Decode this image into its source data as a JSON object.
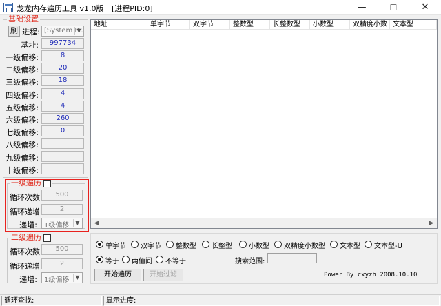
{
  "window": {
    "title": "龙龙内存遍历工具 v1.0版",
    "pid_label": "[进程PID:0]",
    "minimize": "—",
    "maximize": "☐",
    "close": "✕"
  },
  "basic": {
    "title": "基础设置",
    "refresh_label": "刷",
    "process_label": "进程:",
    "process_value": "[System Pr...",
    "base_label": "基址:",
    "base_value": "997734",
    "offsets": [
      {
        "label": "一级偏移:",
        "value": "8"
      },
      {
        "label": "二级偏移:",
        "value": "20"
      },
      {
        "label": "三级偏移:",
        "value": "18"
      },
      {
        "label": "四级偏移:",
        "value": "4"
      },
      {
        "label": "五级偏移:",
        "value": "4"
      },
      {
        "label": "六级偏移:",
        "value": "260"
      },
      {
        "label": "七级偏移:",
        "value": "0"
      },
      {
        "label": "八级偏移:",
        "value": ""
      },
      {
        "label": "九级偏移:",
        "value": ""
      },
      {
        "label": "十级偏移:",
        "value": ""
      }
    ]
  },
  "traverse1": {
    "title": "一级遍历",
    "count_label": "循环次数:",
    "count_value": "500",
    "step_label": "循环递增:",
    "step_value": "2",
    "inc_label": "递增:",
    "inc_value": "1级偏移"
  },
  "traverse2": {
    "title": "二级遍历",
    "count_label": "循环次数:",
    "count_value": "500",
    "step_label": "循环递增:",
    "step_value": "2",
    "inc_label": "递增:",
    "inc_value": "1级偏移"
  },
  "table": {
    "columns": [
      "地址",
      "单字节",
      "双字节",
      "整数型",
      "长整数型",
      "小数型",
      "双精度小数",
      "文本型"
    ]
  },
  "types": [
    {
      "label": "单字节",
      "selected": true
    },
    {
      "label": "双字节",
      "selected": false
    },
    {
      "label": "整数型",
      "selected": false
    },
    {
      "label": "长整型",
      "selected": false
    },
    {
      "label": "小数型",
      "selected": false
    },
    {
      "label": "双精度小数型",
      "selected": false
    },
    {
      "label": "文本型",
      "selected": false
    },
    {
      "label": "文本型-U",
      "selected": false
    }
  ],
  "compare": [
    {
      "label": "等于",
      "selected": true
    },
    {
      "label": "两值间",
      "selected": false
    },
    {
      "label": "不等于",
      "selected": false
    }
  ],
  "search_range_label": "搜索范围:",
  "buttons": {
    "start": "开始遍历",
    "filter": "开始过滤"
  },
  "power_by": "Power By cxyzh 2008.10.10",
  "status": {
    "loop_search": "循环查找:",
    "progress": "显示进度:"
  },
  "colors": {
    "accent": "#e0271a",
    "highlight": "#e8221e",
    "value": "#1f2bb8"
  }
}
